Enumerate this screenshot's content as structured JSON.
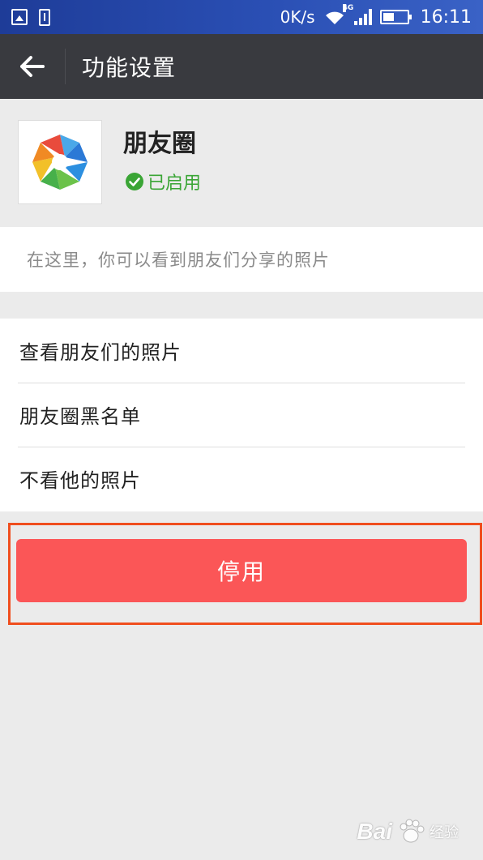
{
  "status_bar": {
    "speed": "0K/s",
    "network": "4G",
    "time": "16:11",
    "battery_level": 0.45
  },
  "action_bar": {
    "title": "功能设置"
  },
  "app": {
    "name": "朋友圈",
    "status": "已启用",
    "description": "在这里，你可以看到朋友们分享的照片"
  },
  "menu": {
    "items": [
      {
        "label": "查看朋友们的照片"
      },
      {
        "label": "朋友圈黑名单"
      },
      {
        "label": "不看他的照片"
      }
    ]
  },
  "actions": {
    "disable_label": "停用"
  },
  "watermark": {
    "brand": "Bai",
    "label": "经验"
  },
  "colors": {
    "status_bar": "#2a4fb4",
    "action_bar": "#393a3f",
    "enabled_green": "#3aa535",
    "disable_red": "#fb5657",
    "highlight_frame": "#f04e1e"
  }
}
